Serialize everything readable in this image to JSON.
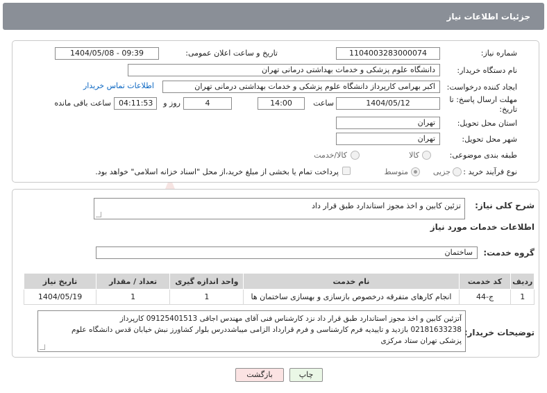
{
  "header": {
    "title": "جزئیات اطلاعات نیاز"
  },
  "form": {
    "need_number_label": "شماره نیاز:",
    "need_number": "1104003283000074",
    "announce_label": "تاریخ و ساعت اعلان عمومی:",
    "announce_value": "1404/05/08 - 09:39",
    "buyer_org_label": "نام دستگاه خریدار:",
    "buyer_org": "دانشگاه علوم پزشکی و خدمات بهداشتی درمانی تهران",
    "creator_label": "ایجاد کننده درخواست:",
    "creator": "اکبر  بهرامی  کارپرداز دانشگاه علوم پزشکی و خدمات بهداشتی درمانی تهران",
    "contact_link": "اطلاعات تماس خریدار",
    "deadline_label_1": "مهلت ارسال پاسخ: تا",
    "deadline_label_2": "تاریخ:",
    "deadline_date": "1404/05/12",
    "time_label": "ساعت",
    "deadline_time": "14:00",
    "days_value": "4",
    "days_label": "روز و",
    "remaining_value": "04:11:53",
    "remaining_label": "ساعت باقی مانده",
    "province_label": "استان محل تحویل:",
    "province": "تهران",
    "city_label": "شهر محل تحویل:",
    "city": "تهران",
    "category_label": "طبقه بندی موضوعی:",
    "category_options": [
      "کالا",
      "کالا/خدمت"
    ],
    "process_label": "نوع فرآیند خرید :",
    "process_options": [
      "جزیی",
      "متوسط"
    ],
    "payment_note": "پرداخت تمام یا بخشی از مبلغ خرید،از محل \"اسناد خزانه اسلامی\" خواهد بود."
  },
  "summary": {
    "label": "شرح کلی نیاز:",
    "text": "تزئین کابین و اخذ مجوز استاندارد طبق قرار داد"
  },
  "services": {
    "section_title": "اطلاعات خدمات مورد نیاز",
    "group_label": "گروه خدمت:",
    "group_value": "ساختمان",
    "columns": [
      "ردیف",
      "کد خدمت",
      "نام خدمت",
      "واحد اندازه گیری",
      "تعداد / مقدار",
      "تاریخ نیاز"
    ],
    "rows": [
      [
        "1",
        "ج-44",
        "انجام کارهای متفرقه درخصوص بازسازی و بهسازی ساختمان ها",
        "1",
        "1",
        "1404/05/19"
      ]
    ]
  },
  "buyer_notes": {
    "label": "توضیحات خریدار:",
    "lines": [
      "آتزئین کابین و اخذ مجوز استاندارد طبق قرار داد نزد کارشناس فنی آقای مهندس اجاقی 09125401513 کارپرداز",
      "02181633238 بازدید و تاییدیه فرم کارشناسی و فرم قرارداد الزامی میباشددرس بلوار کشاورز نبش خیابان قدس دانشگاه علوم",
      "پزشکی تهران ستاد مرکزی"
    ]
  },
  "buttons": {
    "print": "چاپ",
    "back": "بازگشت"
  },
  "colors": {
    "header_bg": "#8a8f97",
    "link": "#0a66c2",
    "print_bg": "#eaf7e6",
    "back_bg": "#fbe3e3",
    "table_head": "#d6d6d6"
  }
}
